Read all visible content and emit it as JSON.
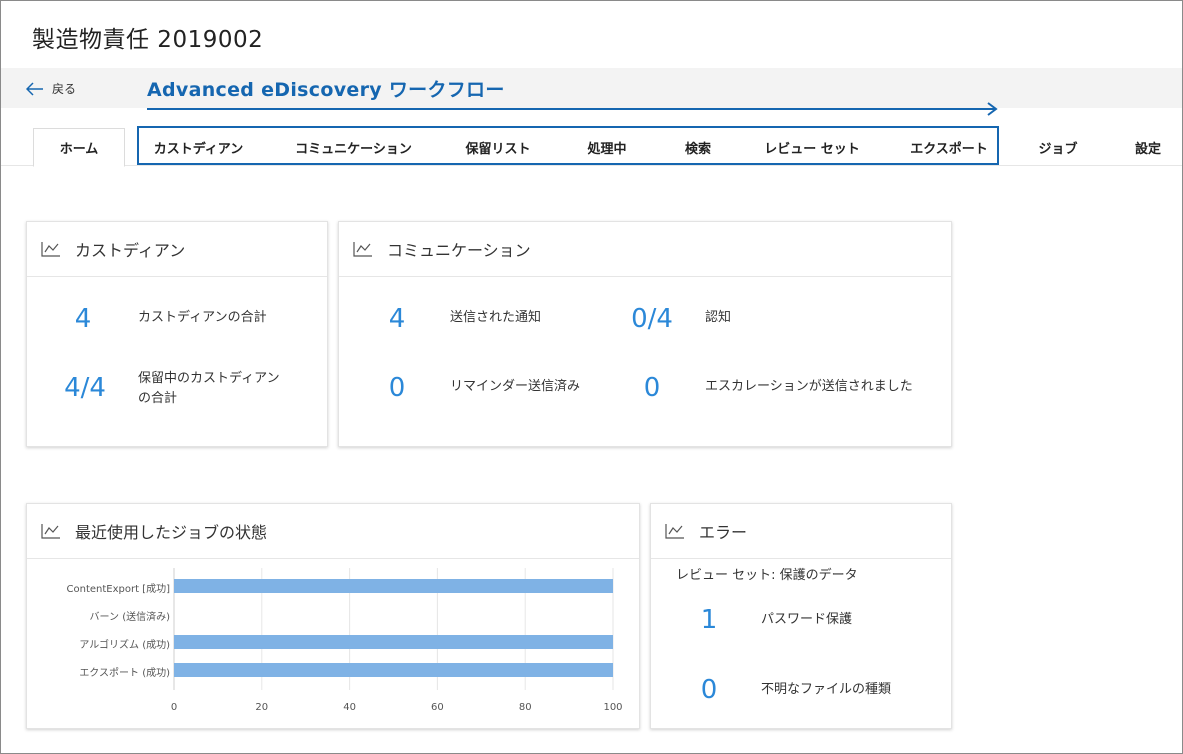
{
  "page": {
    "title": "製造物責任 2019002"
  },
  "back": {
    "label": "戻る"
  },
  "workflow": {
    "label": "Advanced eDiscovery ワークフロー"
  },
  "tabs": [
    {
      "label": "ホーム"
    },
    {
      "label": "カストディアン"
    },
    {
      "label": "コミュニケーション"
    },
    {
      "label": "保留リスト"
    },
    {
      "label": "処理中"
    },
    {
      "label": "検索"
    },
    {
      "label": "レビュー セット"
    },
    {
      "label": "エクスポート"
    },
    {
      "label": "ジョブ"
    },
    {
      "label": "設定"
    }
  ],
  "custodians": {
    "title": "カストディアン",
    "total_value": "4",
    "total_label": "カストディアンの合計",
    "hold_value": "4/4",
    "hold_label_1": "保留中のカストディアン",
    "hold_label_2": "の合計"
  },
  "communications": {
    "title": "コミュニケーション",
    "sent_value": "4",
    "sent_label": "送信された通知",
    "ack_value": "0/4",
    "ack_label": "認知",
    "reminder_value": "0",
    "reminder_label": "リマインダー送信済み",
    "escalation_value": "0",
    "escalation_label": "エスカレーションが送信されました"
  },
  "jobs": {
    "title": "最近使用したジョブの状態"
  },
  "errors": {
    "title": "エラー",
    "subtitle": "レビュー セット: 保護のデータ",
    "password_value": "1",
    "password_label": "パスワード保護",
    "unknown_value": "0",
    "unknown_label": "不明なファイルの種類"
  },
  "colors": {
    "accent": "#1566b0",
    "stat": "#2b88d8",
    "bar": "#7fb2e5"
  },
  "chart_data": {
    "type": "bar",
    "orientation": "horizontal",
    "categories": [
      "ContentExport [成功]",
      "バーン (送信済み)",
      "アルゴリズム (成功)",
      "エクスポート (成功)"
    ],
    "values": [
      100,
      0,
      100,
      100
    ],
    "xlim": [
      0,
      100
    ],
    "xticks": [
      "0",
      "20",
      "40",
      "60",
      "80",
      "100"
    ],
    "grid": true
  }
}
